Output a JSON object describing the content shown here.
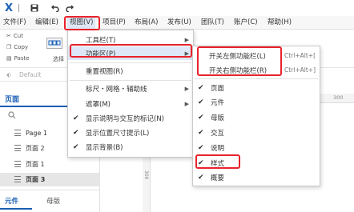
{
  "app": {
    "logo_text": "X",
    "accent_color": "#1a5fb4",
    "highlight_color": "#e8232c"
  },
  "toolbar": {
    "icons": [
      "save-icon",
      "undo-icon",
      "redo-icon"
    ]
  },
  "menubar": {
    "items": [
      {
        "label": "文件(F)"
      },
      {
        "label": "编辑(E)"
      },
      {
        "label": "视图(V)"
      },
      {
        "label": "项目(P)"
      },
      {
        "label": "布局(A)"
      },
      {
        "label": "发布(U)"
      },
      {
        "label": "团队(T)"
      },
      {
        "label": "账户(C)"
      },
      {
        "label": "帮助(H)"
      }
    ]
  },
  "commands": {
    "cut": "Cut",
    "copy": "Copy",
    "paste": "Paste",
    "select_mode": "选择",
    "style_default": "Default"
  },
  "left_panel": {
    "pages_tab": "页面",
    "pages": [
      "Page 1",
      "页面 2",
      "页面 1",
      "页面 3"
    ],
    "bottom_tabs": [
      "元件",
      "母版"
    ]
  },
  "canvas": {
    "ruler_value": "300",
    "vertical_ruler_value": "300"
  },
  "view_menu": {
    "items": [
      {
        "label": "工具栏(T)",
        "has_submenu": true
      },
      {
        "label": "功能区(P)",
        "has_submenu": true
      },
      {
        "label": "重置视图(R)"
      },
      {
        "label": "标尺・网格・辅助线",
        "has_submenu": true
      },
      {
        "label": "遮罩(M)",
        "has_submenu": true
      },
      {
        "label": "显示说明与交互的标记(N)",
        "checked": true
      },
      {
        "label": "显示位置尺寸提示(L)",
        "checked": true
      },
      {
        "label": "显示背景(B)",
        "checked": true
      }
    ]
  },
  "panel_submenu": {
    "items": [
      {
        "label": "开关左侧功能栏(L)",
        "shortcut": "Ctrl+Alt+["
      },
      {
        "label": "开关右侧功能栏(R)",
        "shortcut": "Ctrl+Alt+]"
      },
      {
        "label": "页面",
        "checked": true
      },
      {
        "label": "元件",
        "checked": true
      },
      {
        "label": "母版",
        "checked": true
      },
      {
        "label": "交互",
        "checked": true
      },
      {
        "label": "说明",
        "checked": true
      },
      {
        "label": "样式",
        "checked": true
      },
      {
        "label": "概要",
        "checked": true
      }
    ]
  }
}
